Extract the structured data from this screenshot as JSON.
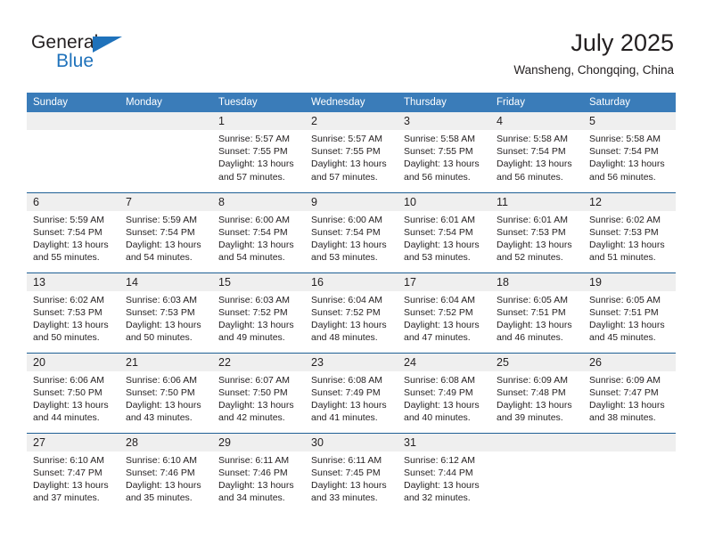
{
  "brand": {
    "word_one": "General",
    "word_two": "Blue",
    "triangle_icon": "brand-triangle-icon",
    "accent_color": "#1f72bb"
  },
  "header": {
    "title": "July 2025",
    "location": "Wansheng, Chongqing, China"
  },
  "theme": {
    "header_row_bg": "#3a7cb9",
    "daynum_bg": "#efefef",
    "row_divider": "#1f6095",
    "text": "#231f20"
  },
  "weekday_headers": [
    "Sunday",
    "Monday",
    "Tuesday",
    "Wednesday",
    "Thursday",
    "Friday",
    "Saturday"
  ],
  "labels": {
    "sunrise_prefix": "Sunrise:",
    "sunset_prefix": "Sunset:",
    "daylight_prefix": "Daylight:"
  },
  "weeks": [
    [
      {
        "day": "",
        "empty": true
      },
      {
        "day": "",
        "empty": true
      },
      {
        "day": "1",
        "sunrise": "Sunrise: 5:57 AM",
        "sunset": "Sunset: 7:55 PM",
        "daylight": "Daylight: 13 hours and 57 minutes."
      },
      {
        "day": "2",
        "sunrise": "Sunrise: 5:57 AM",
        "sunset": "Sunset: 7:55 PM",
        "daylight": "Daylight: 13 hours and 57 minutes."
      },
      {
        "day": "3",
        "sunrise": "Sunrise: 5:58 AM",
        "sunset": "Sunset: 7:55 PM",
        "daylight": "Daylight: 13 hours and 56 minutes."
      },
      {
        "day": "4",
        "sunrise": "Sunrise: 5:58 AM",
        "sunset": "Sunset: 7:54 PM",
        "daylight": "Daylight: 13 hours and 56 minutes."
      },
      {
        "day": "5",
        "sunrise": "Sunrise: 5:58 AM",
        "sunset": "Sunset: 7:54 PM",
        "daylight": "Daylight: 13 hours and 56 minutes."
      }
    ],
    [
      {
        "day": "6",
        "sunrise": "Sunrise: 5:59 AM",
        "sunset": "Sunset: 7:54 PM",
        "daylight": "Daylight: 13 hours and 55 minutes."
      },
      {
        "day": "7",
        "sunrise": "Sunrise: 5:59 AM",
        "sunset": "Sunset: 7:54 PM",
        "daylight": "Daylight: 13 hours and 54 minutes."
      },
      {
        "day": "8",
        "sunrise": "Sunrise: 6:00 AM",
        "sunset": "Sunset: 7:54 PM",
        "daylight": "Daylight: 13 hours and 54 minutes."
      },
      {
        "day": "9",
        "sunrise": "Sunrise: 6:00 AM",
        "sunset": "Sunset: 7:54 PM",
        "daylight": "Daylight: 13 hours and 53 minutes."
      },
      {
        "day": "10",
        "sunrise": "Sunrise: 6:01 AM",
        "sunset": "Sunset: 7:54 PM",
        "daylight": "Daylight: 13 hours and 53 minutes."
      },
      {
        "day": "11",
        "sunrise": "Sunrise: 6:01 AM",
        "sunset": "Sunset: 7:53 PM",
        "daylight": "Daylight: 13 hours and 52 minutes."
      },
      {
        "day": "12",
        "sunrise": "Sunrise: 6:02 AM",
        "sunset": "Sunset: 7:53 PM",
        "daylight": "Daylight: 13 hours and 51 minutes."
      }
    ],
    [
      {
        "day": "13",
        "sunrise": "Sunrise: 6:02 AM",
        "sunset": "Sunset: 7:53 PM",
        "daylight": "Daylight: 13 hours and 50 minutes."
      },
      {
        "day": "14",
        "sunrise": "Sunrise: 6:03 AM",
        "sunset": "Sunset: 7:53 PM",
        "daylight": "Daylight: 13 hours and 50 minutes."
      },
      {
        "day": "15",
        "sunrise": "Sunrise: 6:03 AM",
        "sunset": "Sunset: 7:52 PM",
        "daylight": "Daylight: 13 hours and 49 minutes."
      },
      {
        "day": "16",
        "sunrise": "Sunrise: 6:04 AM",
        "sunset": "Sunset: 7:52 PM",
        "daylight": "Daylight: 13 hours and 48 minutes."
      },
      {
        "day": "17",
        "sunrise": "Sunrise: 6:04 AM",
        "sunset": "Sunset: 7:52 PM",
        "daylight": "Daylight: 13 hours and 47 minutes."
      },
      {
        "day": "18",
        "sunrise": "Sunrise: 6:05 AM",
        "sunset": "Sunset: 7:51 PM",
        "daylight": "Daylight: 13 hours and 46 minutes."
      },
      {
        "day": "19",
        "sunrise": "Sunrise: 6:05 AM",
        "sunset": "Sunset: 7:51 PM",
        "daylight": "Daylight: 13 hours and 45 minutes."
      }
    ],
    [
      {
        "day": "20",
        "sunrise": "Sunrise: 6:06 AM",
        "sunset": "Sunset: 7:50 PM",
        "daylight": "Daylight: 13 hours and 44 minutes."
      },
      {
        "day": "21",
        "sunrise": "Sunrise: 6:06 AM",
        "sunset": "Sunset: 7:50 PM",
        "daylight": "Daylight: 13 hours and 43 minutes."
      },
      {
        "day": "22",
        "sunrise": "Sunrise: 6:07 AM",
        "sunset": "Sunset: 7:50 PM",
        "daylight": "Daylight: 13 hours and 42 minutes."
      },
      {
        "day": "23",
        "sunrise": "Sunrise: 6:08 AM",
        "sunset": "Sunset: 7:49 PM",
        "daylight": "Daylight: 13 hours and 41 minutes."
      },
      {
        "day": "24",
        "sunrise": "Sunrise: 6:08 AM",
        "sunset": "Sunset: 7:49 PM",
        "daylight": "Daylight: 13 hours and 40 minutes."
      },
      {
        "day": "25",
        "sunrise": "Sunrise: 6:09 AM",
        "sunset": "Sunset: 7:48 PM",
        "daylight": "Daylight: 13 hours and 39 minutes."
      },
      {
        "day": "26",
        "sunrise": "Sunrise: 6:09 AM",
        "sunset": "Sunset: 7:47 PM",
        "daylight": "Daylight: 13 hours and 38 minutes."
      }
    ],
    [
      {
        "day": "27",
        "sunrise": "Sunrise: 6:10 AM",
        "sunset": "Sunset: 7:47 PM",
        "daylight": "Daylight: 13 hours and 37 minutes."
      },
      {
        "day": "28",
        "sunrise": "Sunrise: 6:10 AM",
        "sunset": "Sunset: 7:46 PM",
        "daylight": "Daylight: 13 hours and 35 minutes."
      },
      {
        "day": "29",
        "sunrise": "Sunrise: 6:11 AM",
        "sunset": "Sunset: 7:46 PM",
        "daylight": "Daylight: 13 hours and 34 minutes."
      },
      {
        "day": "30",
        "sunrise": "Sunrise: 6:11 AM",
        "sunset": "Sunset: 7:45 PM",
        "daylight": "Daylight: 13 hours and 33 minutes."
      },
      {
        "day": "31",
        "sunrise": "Sunrise: 6:12 AM",
        "sunset": "Sunset: 7:44 PM",
        "daylight": "Daylight: 13 hours and 32 minutes."
      },
      {
        "day": "",
        "empty": true
      },
      {
        "day": "",
        "empty": true
      }
    ]
  ]
}
